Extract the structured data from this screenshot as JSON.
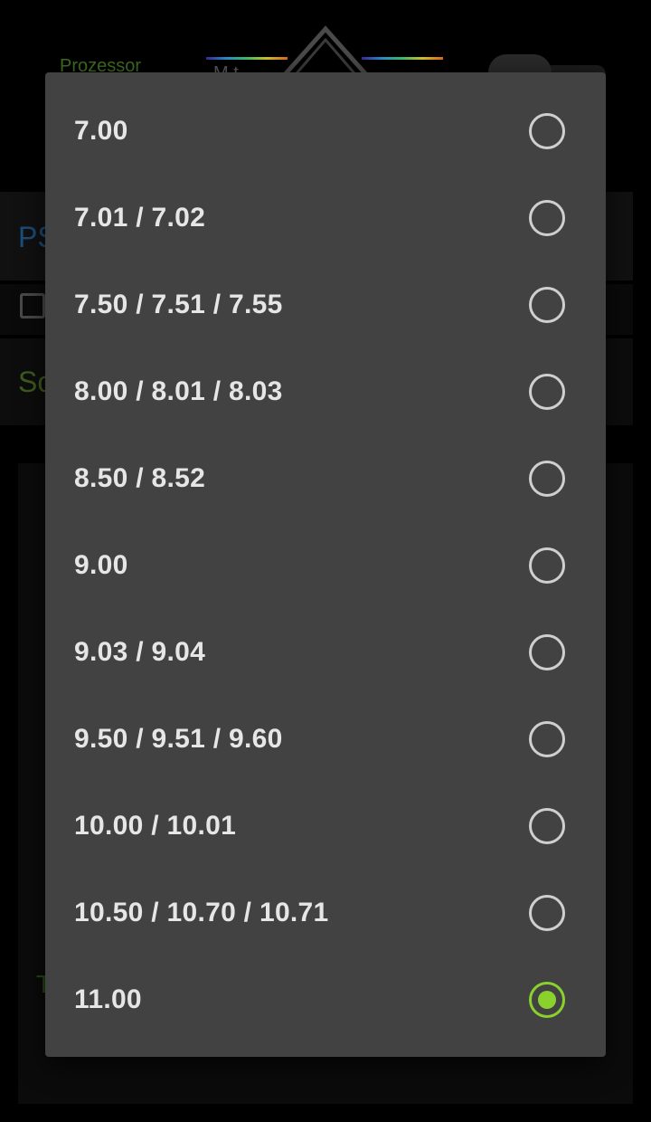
{
  "background": {
    "header_text": "Prozessor",
    "header_text2": "M t",
    "row1_text": "PS",
    "row3_text": "So",
    "panel_text": "T"
  },
  "dialog": {
    "options": [
      {
        "label": "7.00",
        "checked": false
      },
      {
        "label": "7.01 / 7.02",
        "checked": false
      },
      {
        "label": "7.50 / 7.51 / 7.55",
        "checked": false
      },
      {
        "label": "8.00 / 8.01 / 8.03",
        "checked": false
      },
      {
        "label": "8.50 / 8.52",
        "checked": false
      },
      {
        "label": "9.00",
        "checked": false
      },
      {
        "label": "9.03 / 9.04",
        "checked": false
      },
      {
        "label": "9.50 / 9.51 / 9.60",
        "checked": false
      },
      {
        "label": "10.00 / 10.01",
        "checked": false
      },
      {
        "label": "10.50 / 10.70 / 10.71",
        "checked": false
      },
      {
        "label": "11.00",
        "checked": true
      }
    ]
  },
  "colors": {
    "dialog_bg": "#424242",
    "radio_unchecked": "#cfcfcf",
    "radio_checked": "#8bd12d",
    "label_text": "#e6e6e6"
  },
  "icons": {
    "radio_unchecked": "radio-unchecked-icon",
    "radio_checked": "radio-checked-icon"
  }
}
